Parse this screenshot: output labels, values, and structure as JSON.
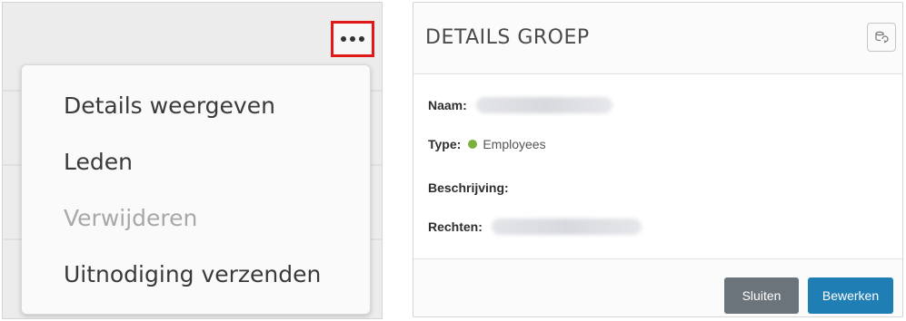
{
  "menu": {
    "more_icon": "more-horizontal-icon",
    "items": [
      {
        "label": "Details weergeven",
        "enabled": true
      },
      {
        "label": "Leden",
        "enabled": true
      },
      {
        "label": "Verwijderen",
        "enabled": false
      },
      {
        "label": "Uitnodiging verzenden",
        "enabled": true
      }
    ]
  },
  "dialog": {
    "title": "DETAILS GROEP",
    "refresh_icon": "refresh-icon",
    "fields": {
      "name_label": "Naam:",
      "type_label": "Type:",
      "type_value": "Employees",
      "type_color": "#7bb03c",
      "description_label": "Beschrijving:",
      "rights_label": "Rechten:"
    },
    "buttons": {
      "close_label": "Sluiten",
      "edit_label": "Bewerken"
    }
  },
  "colors": {
    "highlight_border": "#e01818",
    "edit_button": "#1f7fb5",
    "close_button": "#6b747a"
  }
}
